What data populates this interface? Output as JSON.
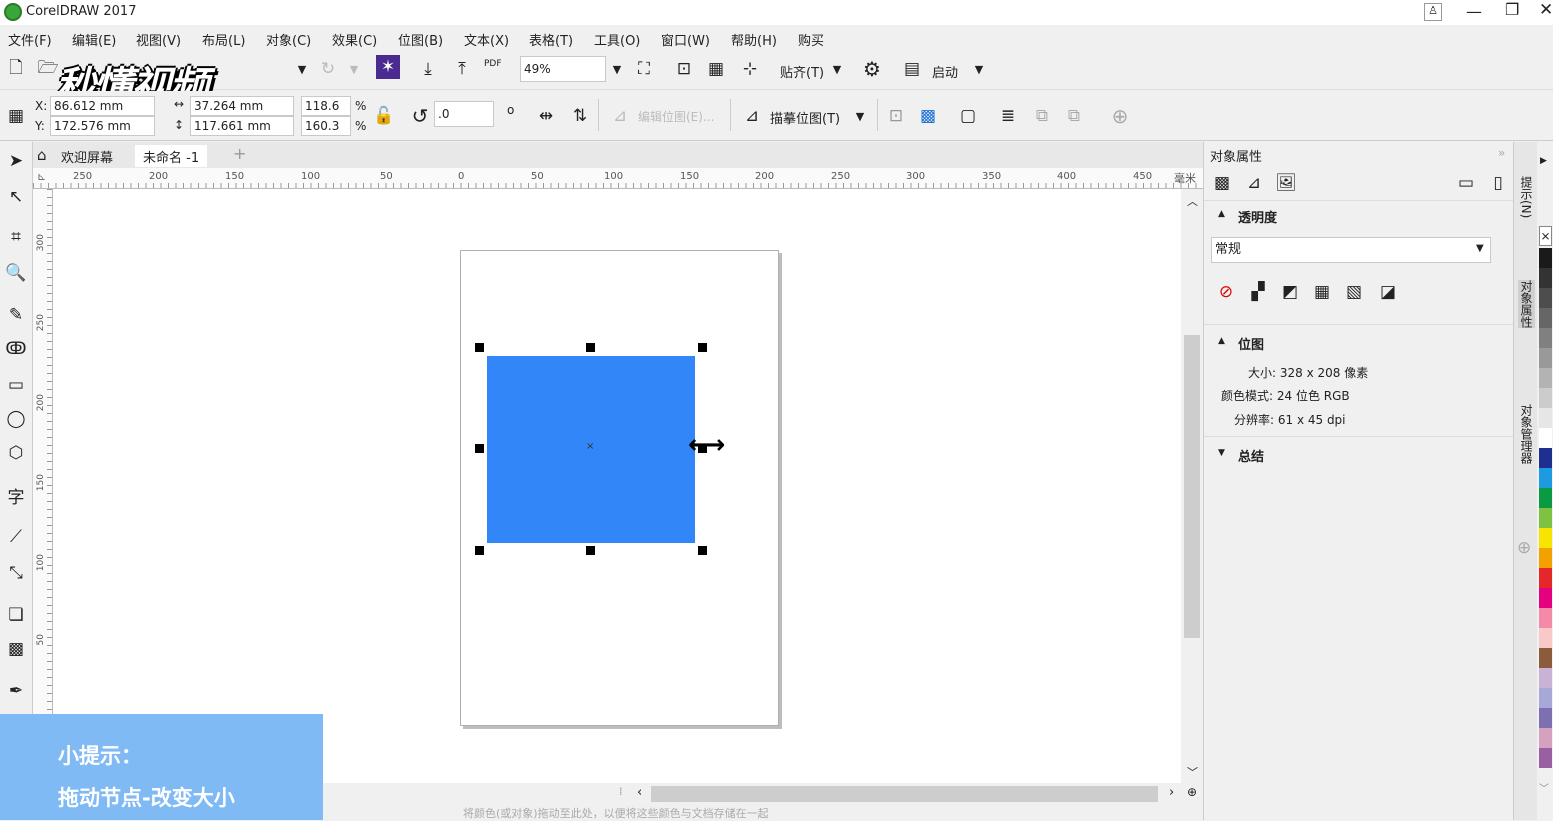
{
  "app": {
    "title": "CorelDRAW 2017"
  },
  "menu": [
    "文件(F)",
    "编辑(E)",
    "视图(V)",
    "布局(L)",
    "对象(C)",
    "效果(C)",
    "位图(B)",
    "文本(X)",
    "表格(T)",
    "工具(O)",
    "窗口(W)",
    "帮助(H)",
    "购买"
  ],
  "watermark": "秒懂视频",
  "toolbar1": {
    "pdf_label": "PDF",
    "zoom": "49%",
    "snap_label": "贴齐(T)",
    "launch_label": "启动"
  },
  "toolbar2": {
    "x_label": "X:",
    "x_value": "86.612 mm",
    "y_label": "Y:",
    "y_value": "172.576 mm",
    "width_value": "37.264 mm",
    "height_value": "117.661 mm",
    "scale_w": "118.6",
    "scale_h": "160.3",
    "pct": "%",
    "rotation": ".0",
    "degree": "o",
    "edit_bitmap": "编辑位图(E)...",
    "trace_bitmap": "描摹位图(T)"
  },
  "tabs": {
    "welcome": "欢迎屏幕",
    "doc": "未命名 -1",
    "add": "+"
  },
  "ruler": {
    "h_ticks": [
      "250",
      "200",
      "150",
      "100",
      "50",
      "0",
      "50",
      "100",
      "150",
      "200",
      "250",
      "300",
      "350",
      "400",
      "450"
    ],
    "unit": "毫米",
    "v_ticks": [
      "300",
      "250",
      "200",
      "150",
      "100",
      "50"
    ]
  },
  "docker": {
    "title": "对象属性",
    "transparency": "透明度",
    "transparency_mode": "常规",
    "bitmap": "位图",
    "size": "大小: 328 x 208 像素",
    "color_mode": "颜色模式: 24 位色 RGB",
    "resolution": "分辨率: 61 x 45 dpi",
    "summary": "总结"
  },
  "side_tabs": [
    "提示(N)",
    "对象属性",
    "对象管理器"
  ],
  "palette": [
    "#1a1a1a",
    "#333333",
    "#4d4d4d",
    "#666666",
    "#808080",
    "#999999",
    "#b3b3b3",
    "#cccccc",
    "#e6e6e6",
    "#ffffff",
    "#1f2f8f",
    "#1e9be0",
    "#0a9a44",
    "#7fc241",
    "#f7e400",
    "#f2a100",
    "#e5262b",
    "#e4007f",
    "#f48aa8",
    "#f9c8c8",
    "#8b5b3b",
    "#c8b3d6",
    "#a8a8d8",
    "#7e6fb0",
    "#d6a0c0",
    "#9a5fa0"
  ],
  "status": {
    "hint": "将颜色(或对象)拖动至此处，以便将这些颜色与文档存储在一起"
  },
  "tip": {
    "line1": "小提示：",
    "line2": "拖动节点-改变大小"
  }
}
